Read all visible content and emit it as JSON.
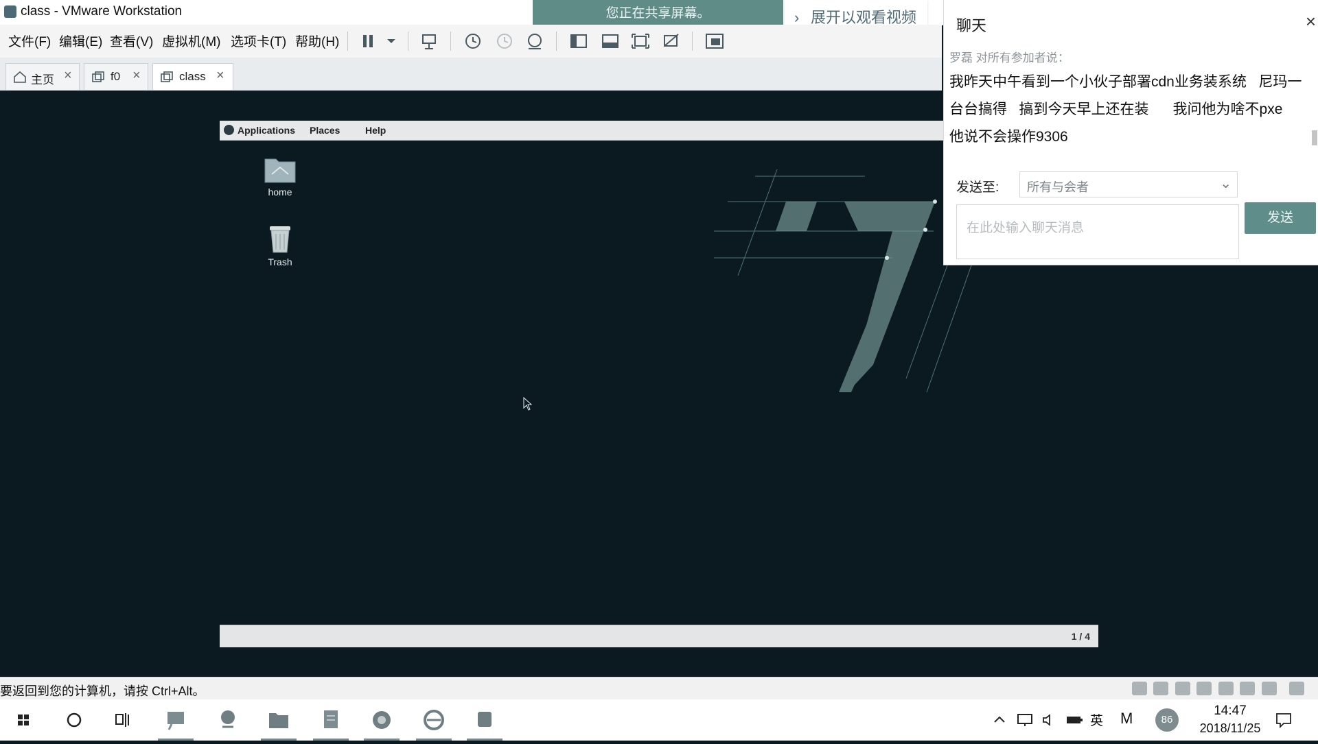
{
  "window": {
    "title": "class - VMware Workstation"
  },
  "share_banner": "您正在共享屏幕。",
  "expand_video": "展开以观看视频",
  "menu": [
    "文件(F)",
    "编辑(E)",
    "查看(V)",
    "虚拟机(M)",
    "选项卡(T)",
    "帮助(H)"
  ],
  "tabs": [
    {
      "label": "主页",
      "icon": "home-icon"
    },
    {
      "label": "f0",
      "icon": "vm-icon"
    },
    {
      "label": "class",
      "icon": "vm-icon",
      "active": true
    }
  ],
  "guest": {
    "panel_menus": [
      "Applications",
      "Places",
      "Help"
    ],
    "desktop_icons": [
      {
        "label": "home",
        "icon": "folder-icon"
      },
      {
        "label": "Trash",
        "icon": "trash-icon"
      }
    ],
    "pager": "1 / 4"
  },
  "statusbar": {
    "hint": "要返回到您的计算机，请按 Ctrl+Alt。"
  },
  "chat": {
    "title": "聊天",
    "sender": "罗磊 对所有参加者说：",
    "message": "我昨天中午看到一个小伙子部署cdn业务装系统   尼玛一台台搞得   搞到今天早上还在装      我问他为啥不pxe   他说不会操作9306",
    "send_to_label": "发送至:",
    "send_to_value": "所有与会者",
    "input_placeholder": "在此处输入聊天消息",
    "send_button": "发送"
  },
  "taskbar": {
    "tray_lang": "英",
    "tray_m": "M",
    "badge": "86",
    "time": "14:47",
    "date": "2018/11/25"
  },
  "colors": {
    "accent": "#5e8d8a",
    "vm_bg": "#0a1a20",
    "banner": "#5f8c86"
  }
}
